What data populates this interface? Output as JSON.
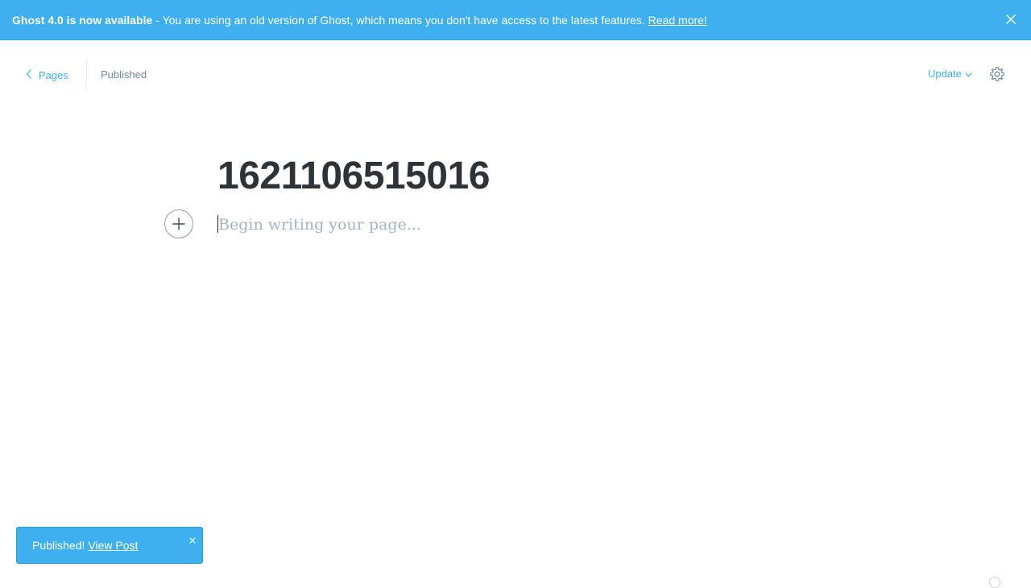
{
  "banner": {
    "title": "Ghost 4.0 is now available",
    "message": "- You are using an old version of Ghost, which means you don't have access to the latest features.",
    "link": "Read more!",
    "close_icon": "close-icon"
  },
  "header": {
    "back_label": "Pages",
    "back_icon": "chevron-left-icon",
    "status": "Published",
    "update_label": "Update",
    "update_icon": "chevron-down-icon",
    "settings_icon": "gear-icon"
  },
  "editor": {
    "title": "1621106515016",
    "body_placeholder": "Begin writing your page...",
    "plus_icon": "plus-icon"
  },
  "toast": {
    "message": "Published!",
    "link": "View Post",
    "close_icon": "close-icon"
  },
  "colors": {
    "accent": "#3eb0ef",
    "title": "#2e3338",
    "muted": "#738a94",
    "placeholder": "#a5b4c0"
  }
}
